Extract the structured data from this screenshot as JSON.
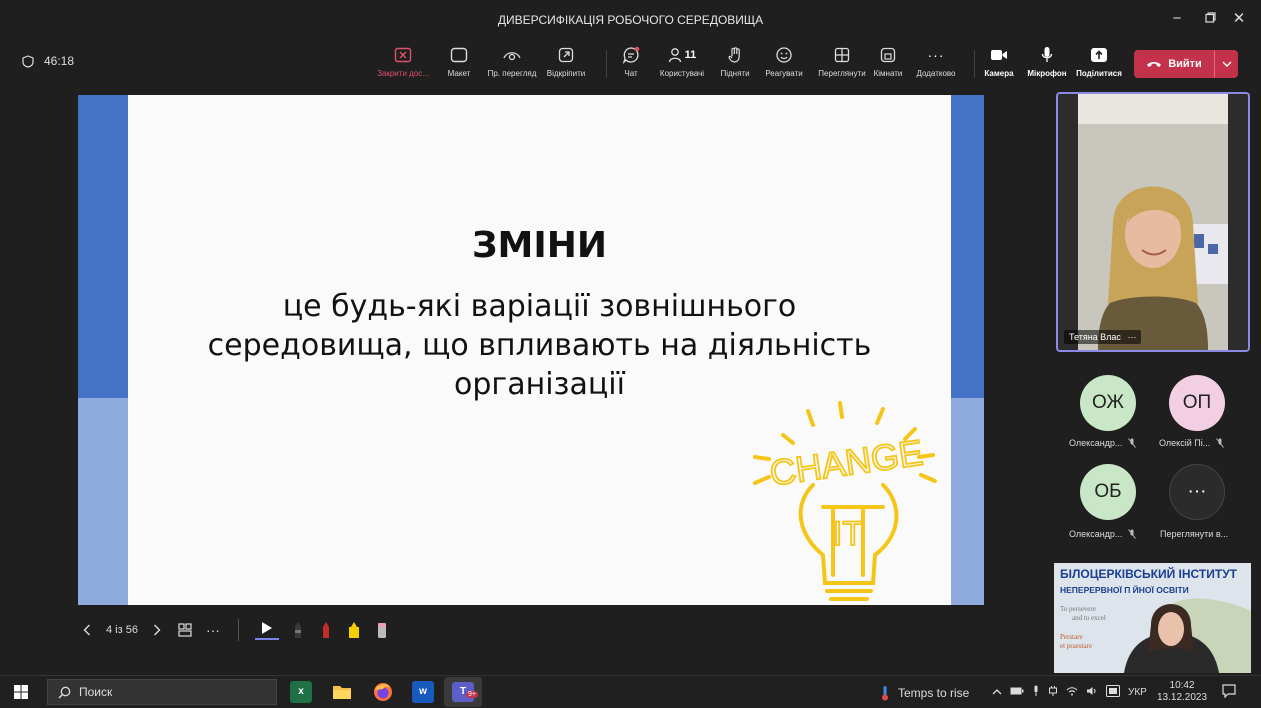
{
  "window": {
    "title": "ДИВЕРСИФІКАЦІЯ РОБОЧОГО СЕРЕДОВИЩА",
    "controls": [
      "minimize-icon",
      "restore-icon",
      "close-icon"
    ]
  },
  "meeting": {
    "timer": "46:18",
    "toolbar": {
      "stop_sharing": "Закрити дос...",
      "layout": "Макет",
      "presenter_view": "Пр. перегляд",
      "pop_out": "Відкріпити",
      "chat": "Чат",
      "people": "Користувачі",
      "people_count": "11",
      "raise": "Підняти",
      "react": "Реагувати",
      "view": "Переглянути",
      "rooms": "Кімнати",
      "more": "Додатково",
      "camera": "Камера",
      "mic": "Мікрофон",
      "share": "Поділитися",
      "leave": "Вийти"
    }
  },
  "slide": {
    "title": "ЗМІНИ",
    "body_lines": [
      "це будь-які варіації зовнішнього",
      "середовища, що впливають на діяльність",
      "організації"
    ],
    "art_text_1": "CHANGE",
    "art_text_2": "IT",
    "accent_dark": "#4472c4",
    "accent_light": "#8faadc",
    "art_color": "#f5c518"
  },
  "slide_controls": {
    "counter": "4 із 56"
  },
  "participants": {
    "presenter_name": "Тетяна Влас",
    "tiles": [
      {
        "initials": "ОЖ",
        "name": "Олександр...",
        "color": "#c9e7c6"
      },
      {
        "initials": "ОП",
        "name": "Олексій Пі...",
        "color": "#f3cfe4"
      },
      {
        "initials": "ОБ",
        "name": "Олександр...",
        "color": "#c9e7c6"
      },
      {
        "initials": "···",
        "name": "Переглянути в...",
        "color": "#2b2b2b"
      }
    ],
    "logo_video": {
      "line1": "БІЛОЦЕРКІВСЬКИЙ ІНСТИТУТ",
      "line2": "НЕПЕРЕРВНОЇ П     ЙНОЇ ОСВІТИ",
      "line3a": "To persevere",
      "line3b": "and to excel",
      "line4a": "Perstare",
      "line4b": "et praestare"
    }
  },
  "taskbar": {
    "search_placeholder": "Поиск",
    "weather": "Temps to rise",
    "lang": "УКР",
    "time": "10:42",
    "date": "13.12.2023",
    "teams_badge": "9+"
  }
}
